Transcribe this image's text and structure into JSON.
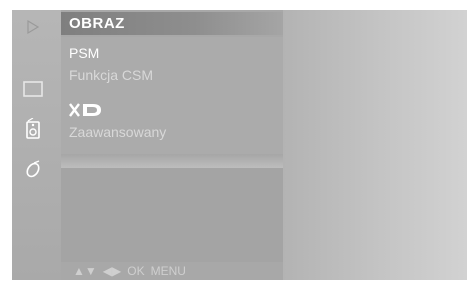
{
  "menu": {
    "title": "OBRAZ",
    "items": [
      {
        "label": "PSM",
        "state": "active"
      },
      {
        "label": "Funkcja CSM",
        "state": "dim"
      },
      {
        "label": "XD",
        "state": "logo"
      },
      {
        "label": "Zaawansowany",
        "state": "dim"
      }
    ]
  },
  "sidebar": {
    "icons": [
      "play-icon",
      "screen-icon",
      "speaker-icon",
      "satellite-icon"
    ]
  },
  "nav_hint": {
    "updown": "▲▼",
    "leftright": "◀▶",
    "ok": "OK",
    "menu": "MENU"
  }
}
